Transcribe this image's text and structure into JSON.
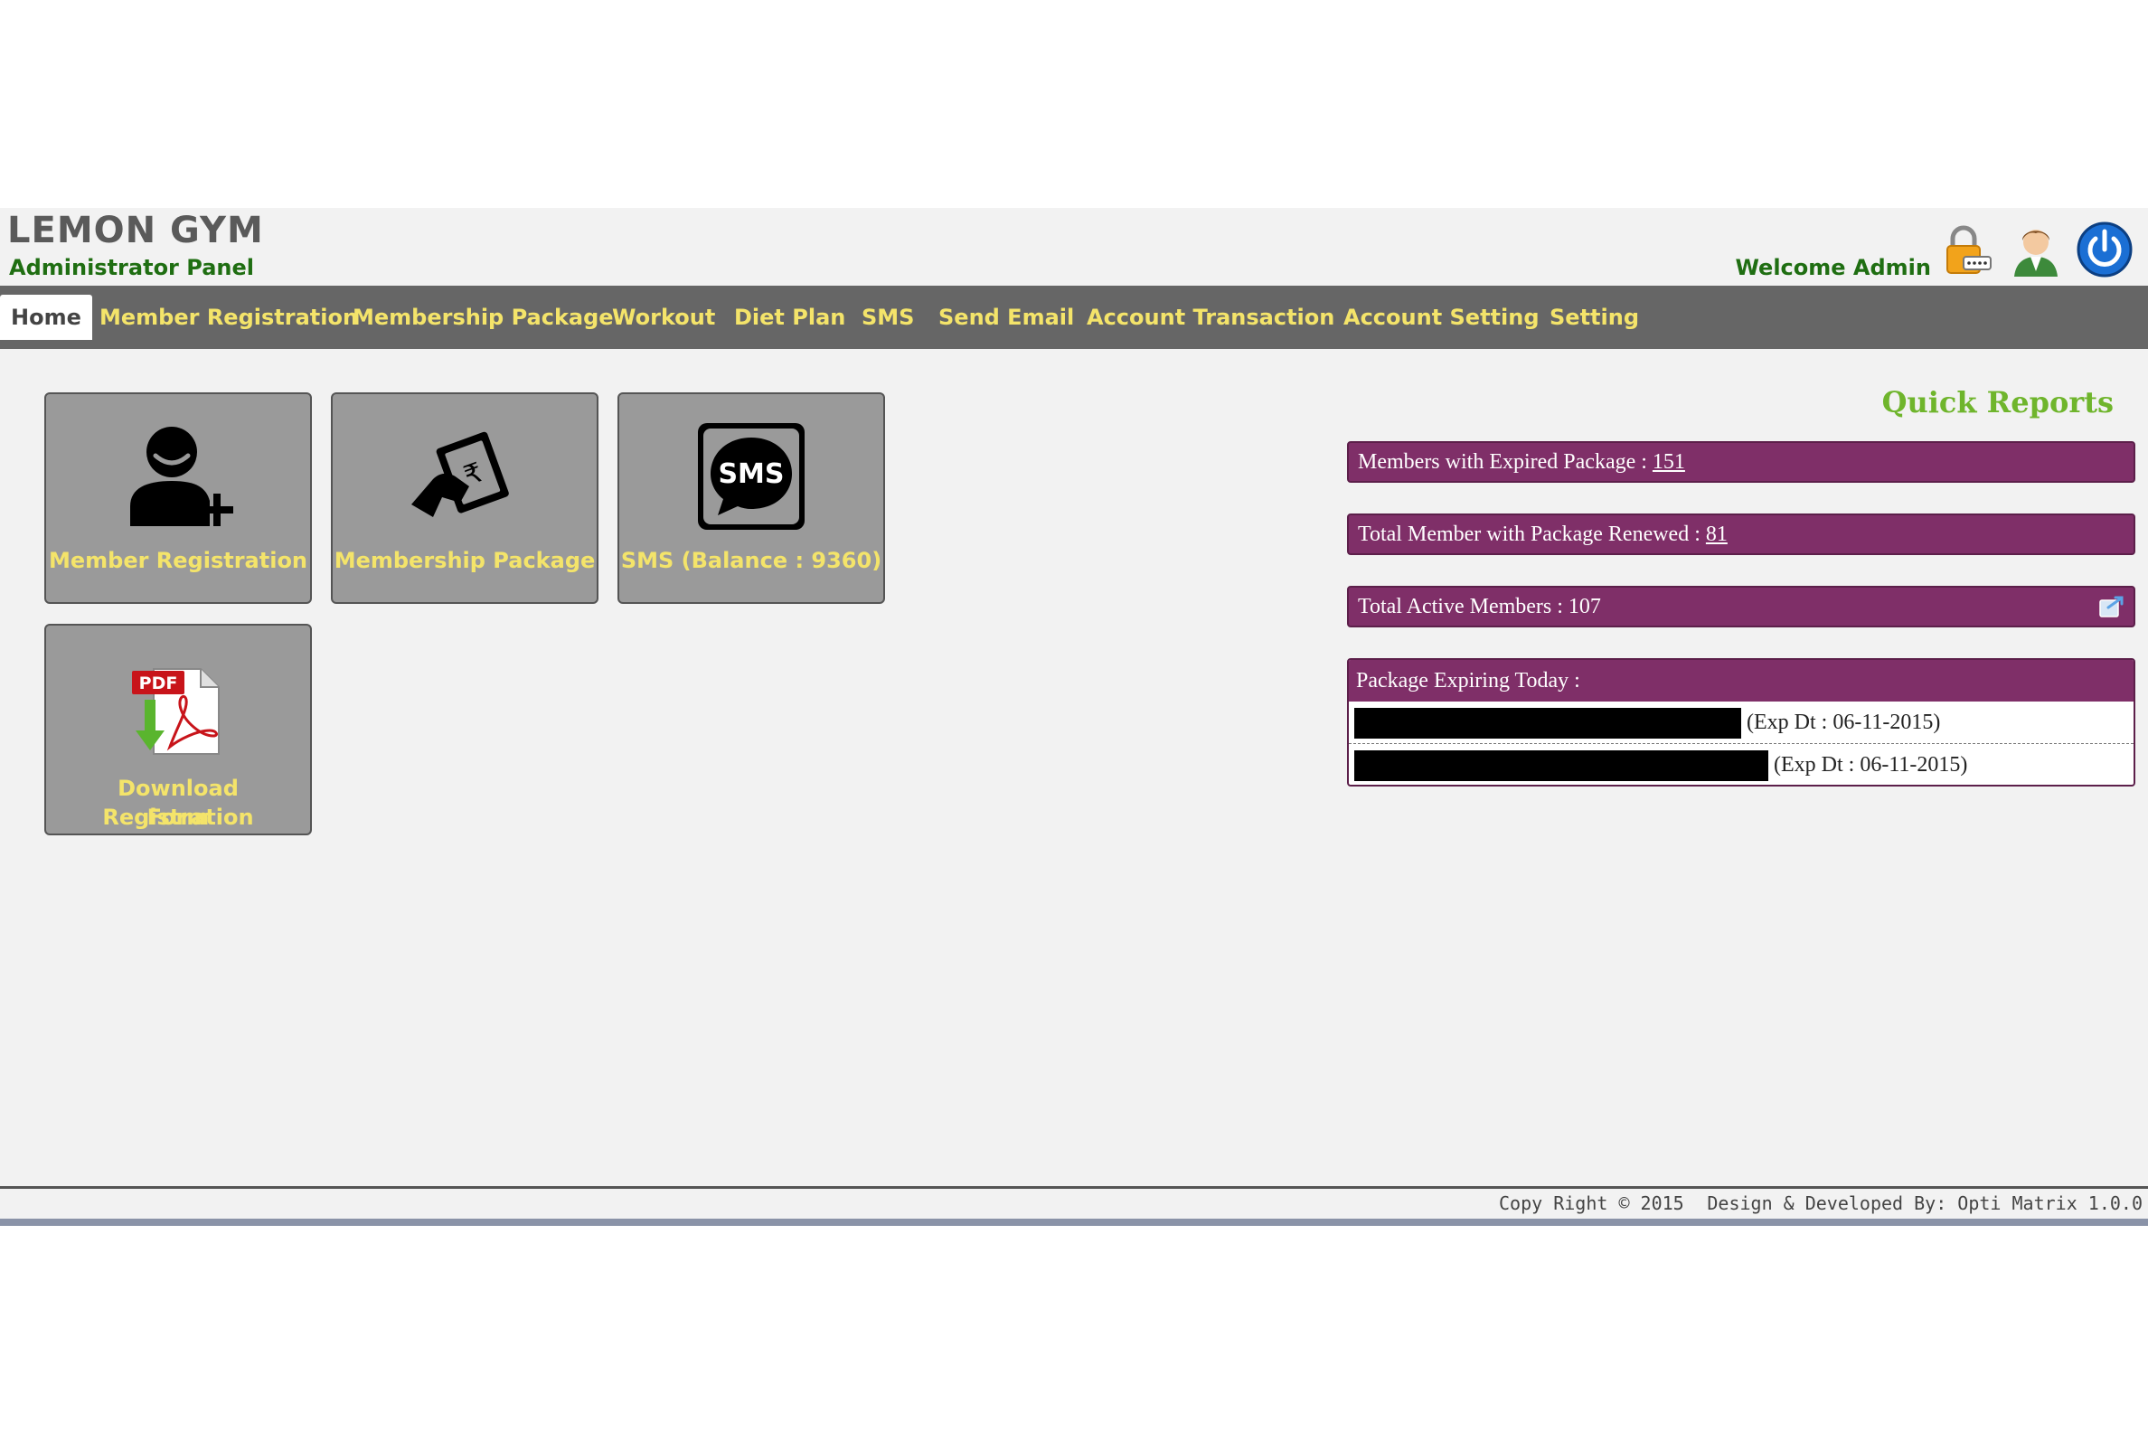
{
  "header": {
    "app_title": "LEMON GYM",
    "subtitle": "Administrator Panel",
    "welcome": "Welcome Admin",
    "icons": [
      "lock-icon",
      "user-profile-icon",
      "power-icon"
    ]
  },
  "nav": {
    "items": [
      {
        "label": "Home",
        "active": true
      },
      {
        "label": "Member Registration"
      },
      {
        "label": "Membership Package"
      },
      {
        "label": "Workout"
      },
      {
        "label": "Diet Plan"
      },
      {
        "label": "SMS"
      },
      {
        "label": "Send Email"
      },
      {
        "label": "Account Transaction"
      },
      {
        "label": "Account Setting"
      },
      {
        "label": "Setting"
      }
    ]
  },
  "tiles": [
    {
      "label": "Member Registration",
      "icon": "add-user-icon"
    },
    {
      "label": "Membership Package",
      "icon": "money-hand-icon"
    },
    {
      "label": "SMS (Balance : 9360)",
      "icon": "sms-icon"
    },
    {
      "label_line1": "Download Registration",
      "label_line2": "Form",
      "icon": "pdf-download-icon"
    }
  ],
  "quick_reports": {
    "title": "Quick Reports",
    "expired": {
      "label": "Members with Expired Package : ",
      "value": "151"
    },
    "renewed": {
      "label": "Total Member with Package Renewed : ",
      "value": "81"
    },
    "active": {
      "label": "Total Active Members : 107",
      "icon": "export-icon"
    },
    "expiring": {
      "header": "Package Expiring Today :",
      "rows": [
        {
          "exp": "(Exp Dt : 06-11-2015)"
        },
        {
          "exp": "(Exp Dt : 06-11-2015)"
        }
      ]
    }
  },
  "footer": {
    "copyright": "Copy Right © 2015",
    "credits": "Design & Developed By: Opti Matrix 1.0.0"
  },
  "colors": {
    "nav_bg": "#666666",
    "nav_text": "#f4e46a",
    "report_bar": "#7f2f68",
    "brand_green": "#1f6e12",
    "quick_reports_green": "#6fb52c"
  }
}
